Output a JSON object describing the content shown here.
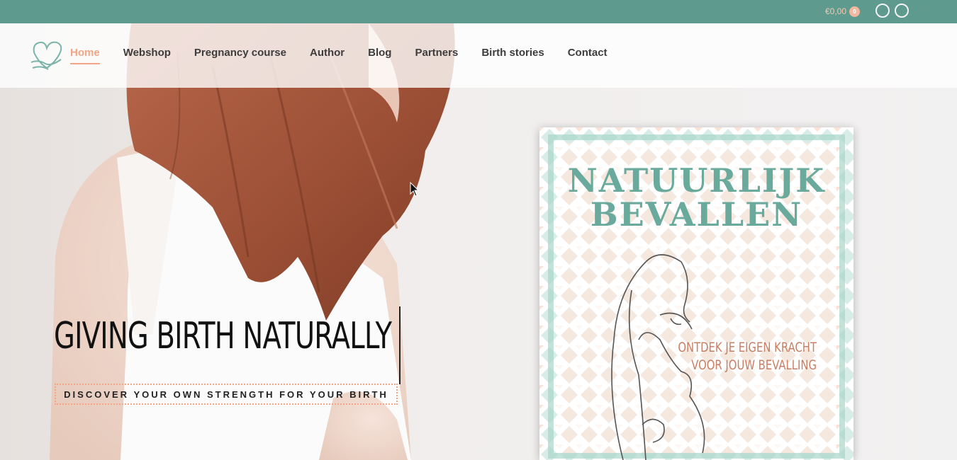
{
  "topbar": {
    "cart_total": "€0,00",
    "cart_count": "0",
    "colors": {
      "bar": "#5e9a8e",
      "accent": "#f3a586"
    }
  },
  "header": {
    "logo_icon": "heart-hands-icon",
    "nav": [
      {
        "label": "Home",
        "active": true
      },
      {
        "label": "Webshop"
      },
      {
        "label": "Pregnancy course"
      },
      {
        "label": "Author"
      },
      {
        "label": "Blog"
      },
      {
        "label": "Partners"
      },
      {
        "label": "Birth stories"
      },
      {
        "label": "Contact"
      }
    ]
  },
  "hero": {
    "headline": "GIVING BIRTH NATURALLY",
    "subline": "DISCOVER YOUR OWN STRENGTH FOR YOUR BIRTH",
    "book": {
      "title_line1": "NATUURLIJK",
      "title_line2": "BEVALLEN",
      "tagline_line1": "ONTDEK  JE EIGEN KRACHT",
      "tagline_line2": "VOOR JOUW BEVALLING"
    }
  }
}
